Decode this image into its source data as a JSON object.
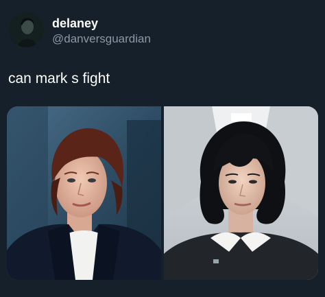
{
  "tweet": {
    "display_name": "delaney",
    "handle": "@danversguardian",
    "text": "can mark s fight"
  },
  "media": {
    "images": [
      {
        "icon": "photo-woman-red-bob"
      },
      {
        "icon": "photo-woman-black-bob"
      }
    ]
  },
  "colors": {
    "background": "#15202b",
    "text_primary": "#ffffff",
    "text_secondary": "#8b98a5"
  }
}
